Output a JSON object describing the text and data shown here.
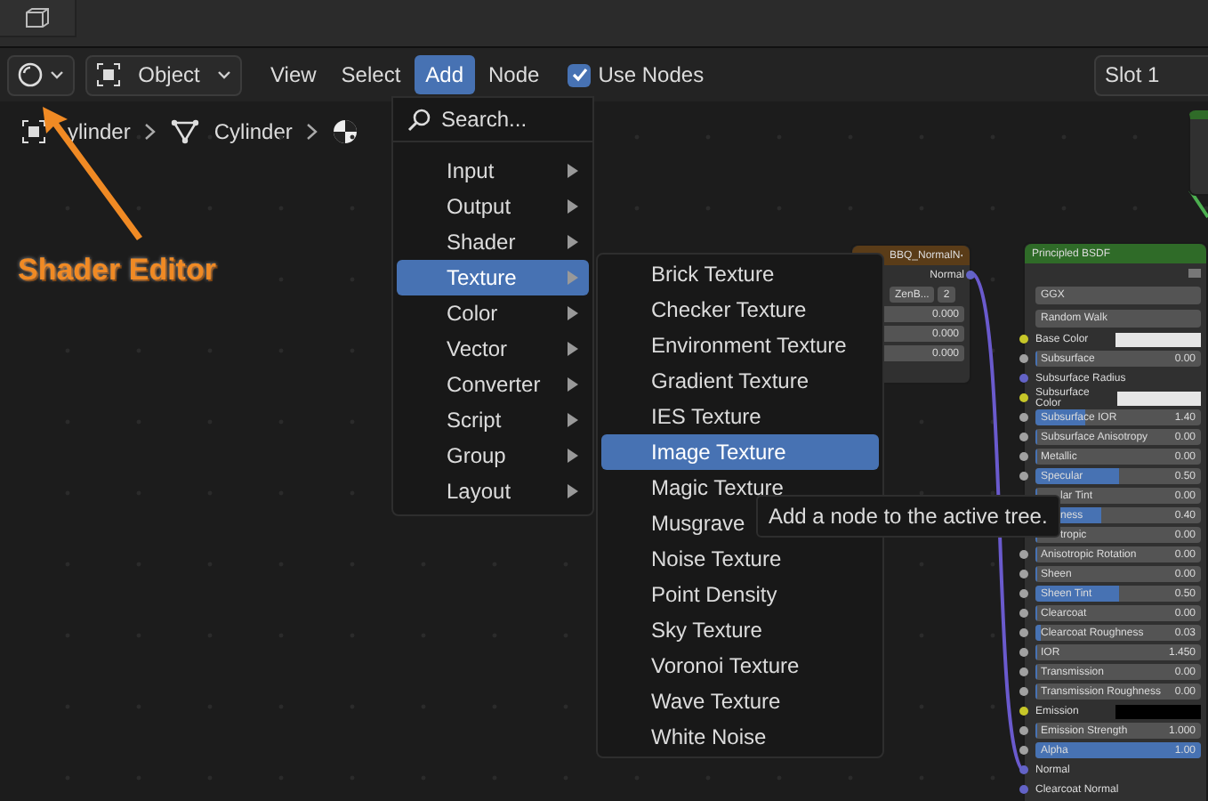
{
  "header": {
    "mode": "Object",
    "menus": [
      {
        "label": "View",
        "selected": false
      },
      {
        "label": "Select",
        "selected": false
      },
      {
        "label": "Add",
        "selected": true
      },
      {
        "label": "Node",
        "selected": false
      }
    ],
    "use_nodes": {
      "label": "Use Nodes",
      "checked": true
    },
    "slot": "Slot 1"
  },
  "breadcrumbs": [
    {
      "label": "ylinder"
    },
    {
      "label": "Cylinder"
    }
  ],
  "annotation": "Shader Editor",
  "add_menu": {
    "search": "Search...",
    "items": [
      {
        "label": "Input",
        "selected": false
      },
      {
        "label": "Output",
        "selected": false
      },
      {
        "label": "Shader",
        "selected": false
      },
      {
        "label": "Texture",
        "selected": true
      },
      {
        "label": "Color",
        "selected": false
      },
      {
        "label": "Vector",
        "selected": false
      },
      {
        "label": "Converter",
        "selected": false
      },
      {
        "label": "Script",
        "selected": false
      },
      {
        "label": "Group",
        "selected": false
      },
      {
        "label": "Layout",
        "selected": false
      }
    ]
  },
  "texture_menu": {
    "items": [
      {
        "label": "Brick Texture",
        "selected": false
      },
      {
        "label": "Checker Texture",
        "selected": false
      },
      {
        "label": "Environment Texture",
        "selected": false
      },
      {
        "label": "Gradient Texture",
        "selected": false
      },
      {
        "label": "IES Texture",
        "selected": false
      },
      {
        "label": "Image Texture",
        "selected": true
      },
      {
        "label": "Magic Texture",
        "selected": false
      },
      {
        "label": "Musgrave",
        "selected": false
      },
      {
        "label": "Noise Texture",
        "selected": false
      },
      {
        "label": "Point Density",
        "selected": false
      },
      {
        "label": "Sky Texture",
        "selected": false
      },
      {
        "label": "Voronoi Texture",
        "selected": false
      },
      {
        "label": "Wave Texture",
        "selected": false
      },
      {
        "label": "White Noise",
        "selected": false
      }
    ]
  },
  "tooltip": "Add a node to the active tree.",
  "image_node": {
    "title": "BBQ_NormalN",
    "output": "Normal",
    "image": "ZenB...",
    "users": "2",
    "values": [
      "0.000",
      "0.000",
      "0.000"
    ]
  },
  "bsdf_node": {
    "title": "Principled BSDF",
    "distribution": "GGX",
    "subsurface_method": "Random Walk",
    "rows": [
      {
        "kind": "color",
        "label": "Base Color",
        "color": "#e6e6e6"
      },
      {
        "kind": "slider",
        "label": "Subsurface",
        "value": "0.00",
        "level": 0
      },
      {
        "kind": "vector",
        "label": "Subsurface Radius"
      },
      {
        "kind": "color",
        "label": "Subsurface Color",
        "color": "#e6e6e6"
      },
      {
        "kind": "slider",
        "label": "Subsurface IOR",
        "value": "1.40",
        "level": 0.3
      },
      {
        "kind": "slider",
        "label": "Subsurface Anisotropy",
        "value": "0.00",
        "level": 0
      },
      {
        "kind": "slider",
        "label": "Metallic",
        "value": "0.00",
        "level": 0
      },
      {
        "kind": "slider",
        "label": "Specular",
        "value": "0.50",
        "level": 0.5
      },
      {
        "kind": "partial",
        "label": "lar Tint",
        "value": "0.00",
        "level": 0
      },
      {
        "kind": "partial",
        "label": "ness",
        "value": "0.40",
        "level": 0.4
      },
      {
        "kind": "partial",
        "label": "tropic",
        "value": "0.00",
        "level": 0
      },
      {
        "kind": "slider",
        "label": "Anisotropic Rotation",
        "value": "0.00",
        "level": 0
      },
      {
        "kind": "slider",
        "label": "Sheen",
        "value": "0.00",
        "level": 0
      },
      {
        "kind": "slider",
        "label": "Sheen Tint",
        "value": "0.50",
        "level": 0.5
      },
      {
        "kind": "slider",
        "label": "Clearcoat",
        "value": "0.00",
        "level": 0
      },
      {
        "kind": "slider",
        "label": "Clearcoat Roughness",
        "value": "0.03",
        "level": 0.03
      },
      {
        "kind": "slider",
        "label": "IOR",
        "value": "1.450",
        "level": 0
      },
      {
        "kind": "slider",
        "label": "Transmission",
        "value": "0.00",
        "level": 0
      },
      {
        "kind": "slider",
        "label": "Transmission Roughness",
        "value": "0.00",
        "level": 0
      },
      {
        "kind": "color",
        "label": "Emission",
        "color": "#000000"
      },
      {
        "kind": "slider",
        "label": "Emission Strength",
        "value": "1.000",
        "level": 0
      },
      {
        "kind": "slider",
        "label": "Alpha",
        "value": "1.00",
        "level": 1
      },
      {
        "kind": "vector",
        "label": "Normal"
      },
      {
        "kind": "vector",
        "label": "Clearcoat Normal"
      }
    ]
  }
}
